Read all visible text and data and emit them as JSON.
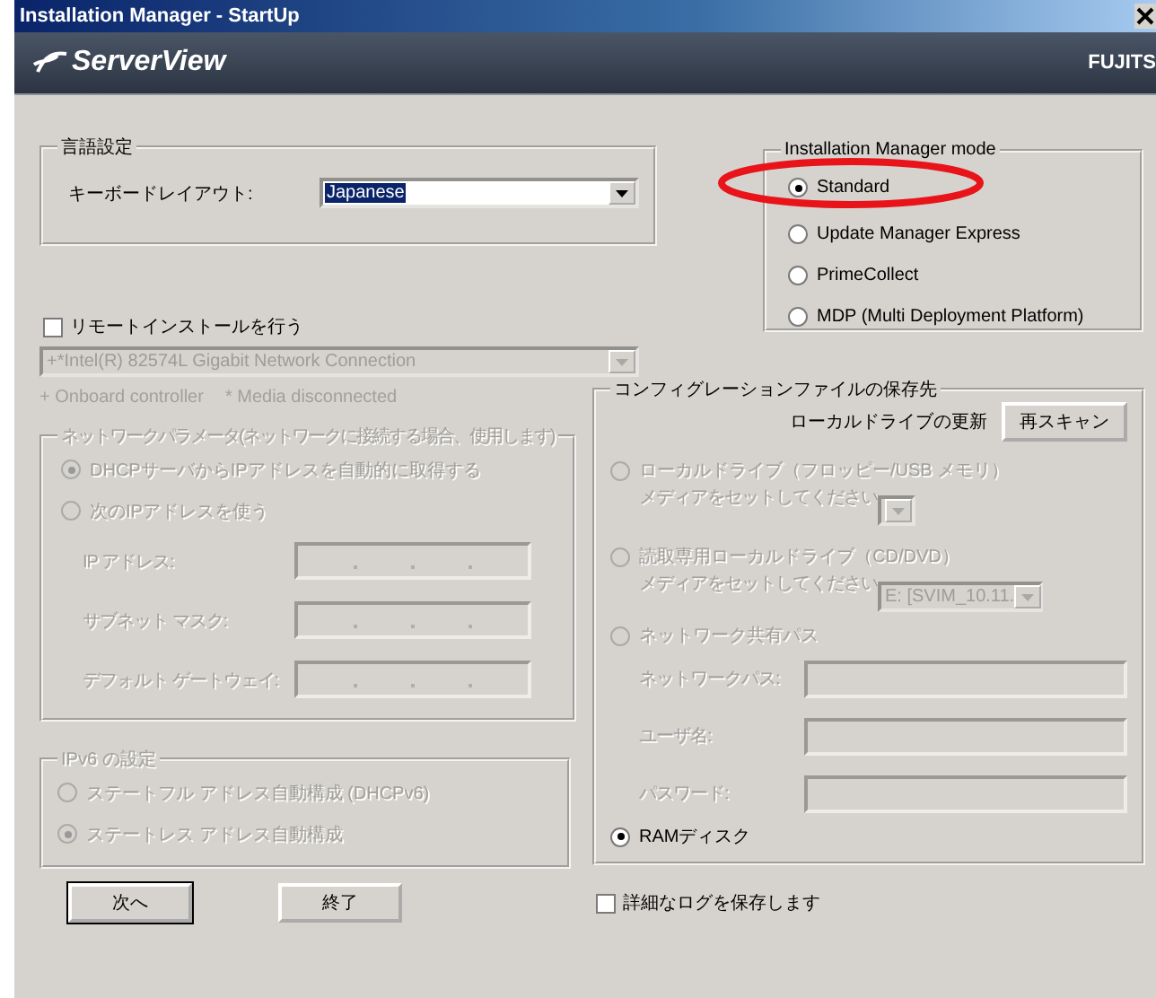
{
  "window": {
    "title": "Installation Manager - StartUp"
  },
  "banner": {
    "product": "ServerView",
    "vendor": "FUJITS"
  },
  "language": {
    "title": "言語設定",
    "keyboard_label": "キーボードレイアウト:",
    "keyboard_value": "Japanese"
  },
  "mode": {
    "title": "Installation Manager mode",
    "options": [
      {
        "label": "Standard",
        "selected": true
      },
      {
        "label": "Update Manager Express",
        "selected": false
      },
      {
        "label": "PrimeCollect",
        "selected": false
      },
      {
        "label": "MDP (Multi Deployment Platform)",
        "selected": false
      }
    ]
  },
  "remote_install": {
    "label": "リモートインストールを行う",
    "checked": false
  },
  "nic": {
    "value": "+*Intel(R) 82574L Gigabit Network Connection",
    "disabled": true,
    "notes": [
      "+ Onboard controller",
      "* Media disconnected"
    ]
  },
  "network": {
    "title": "ネットワークパラメータ(ネットワークに接続する場合、使用します)",
    "disabled": true,
    "options": [
      {
        "label": "DHCPサーバからIPアドレスを自動的に取得する",
        "selected": true
      },
      {
        "label": "次のIPアドレスを使う",
        "selected": false
      }
    ],
    "fields": [
      {
        "label": "IP アドレス:"
      },
      {
        "label": "サブネット マスク:"
      },
      {
        "label": "デフォルト ゲートウェイ:"
      }
    ]
  },
  "ipv6": {
    "title": "IPv6 の設定",
    "disabled": true,
    "options": [
      {
        "label": "ステートフル アドレス自動構成 (DHCPv6)",
        "selected": false
      },
      {
        "label": "ステートレス アドレス自動構成",
        "selected": true
      }
    ]
  },
  "buttons": [
    {
      "label": "次へ"
    },
    {
      "label": "終了"
    }
  ],
  "config": {
    "title": "コンフィグレーションファイルの保存先",
    "refresh_label": "ローカルドライブの更新",
    "rescan_button": "再スキャン",
    "options": [
      {
        "kind": "drive",
        "label": "ローカルドライブ（フロッピー/USB メモリ）",
        "hint": "メディアをセットしてください",
        "selected": false,
        "disabled": true
      },
      {
        "kind": "drive",
        "label": "読取専用ローカルドライブ（CD/DVD）",
        "hint": "メディアをセットしてください",
        "value": "E: [SVIM_10.11.",
        "selected": false,
        "disabled": true
      },
      {
        "kind": "network",
        "label": "ネットワーク共有パス",
        "selected": false,
        "disabled": true,
        "fields": [
          {
            "label": "ネットワークパス:"
          },
          {
            "label": "ユーザ名:"
          },
          {
            "label": "パスワード:"
          }
        ]
      },
      {
        "kind": "ram",
        "label": "RAMディスク",
        "selected": true,
        "disabled": false
      }
    ]
  },
  "detailed_log": {
    "label": "詳細なログを保存します",
    "checked": false
  }
}
